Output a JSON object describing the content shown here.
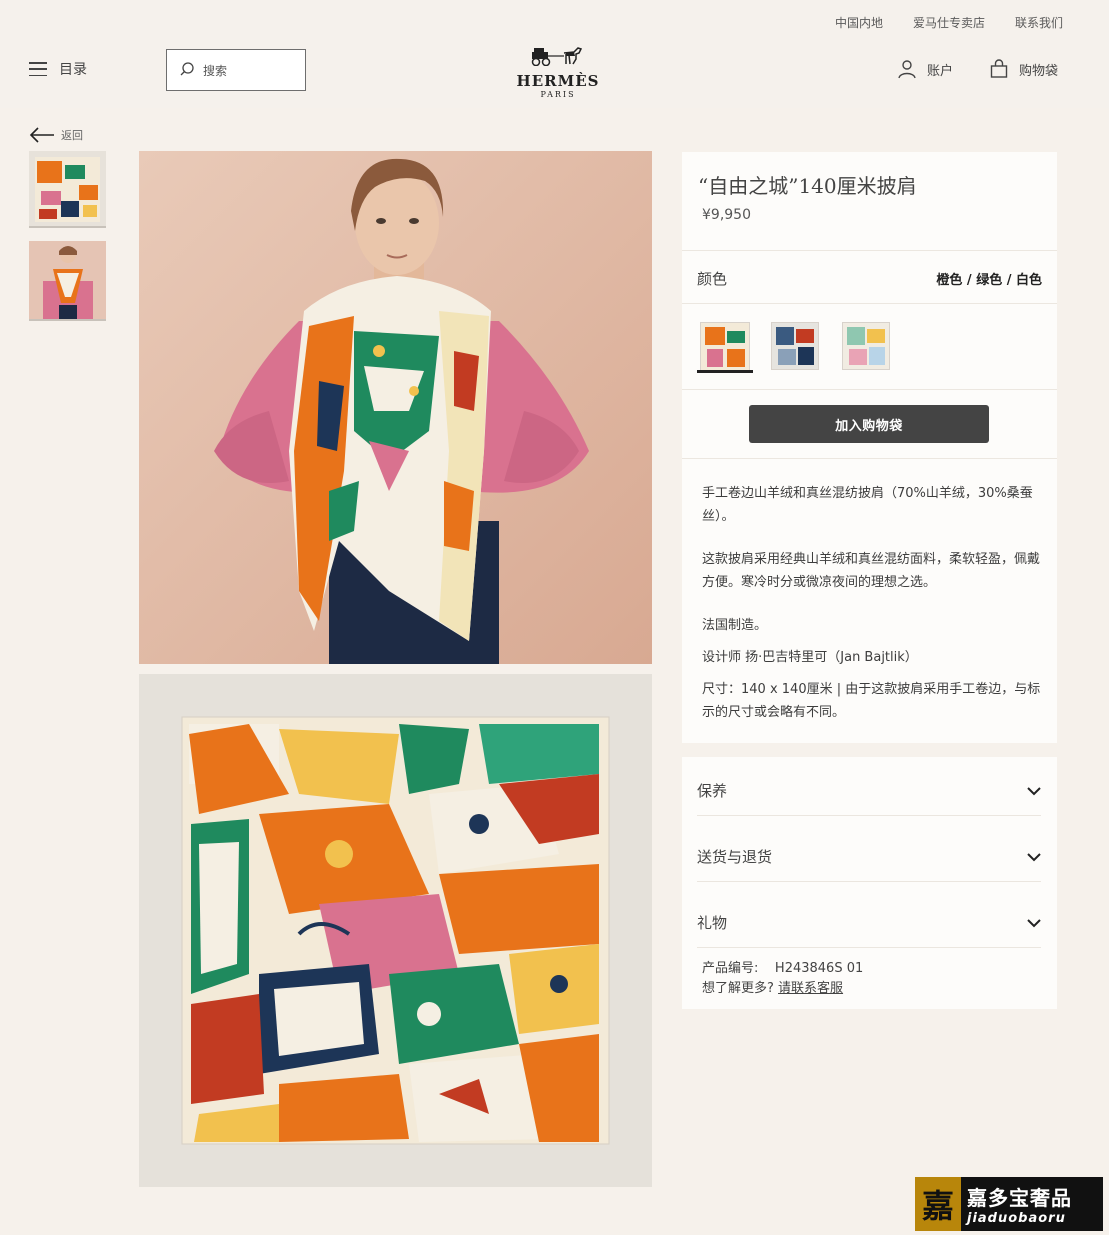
{
  "header": {
    "top_links": [
      "中国内地",
      "爱马仕专卖店",
      "联系我们"
    ],
    "menu_label": "目录",
    "search_placeholder": "搜索",
    "logo_brand": "HERMÈS",
    "logo_city": "PARIS",
    "account_label": "账户",
    "bag_label": "购物袋"
  },
  "back_label": "返回",
  "product": {
    "title": "“自由之城”140厘米披肩",
    "price": "¥9,950",
    "color_label": "颜色",
    "color_name": "橙色 / 绿色 / 白色",
    "add_to_bag": "加入购物袋",
    "desc1": "手工卷边山羊绒和真丝混纺披肩（70%山羊绒，30%桑蚕丝）。",
    "desc2": "这款披肩采用经典山羊绒和真丝混纺面料，柔软轻盈，佩戴方便。寒冷时分或微凉夜间的理想之选。",
    "desc3": "法国制造。",
    "desc4": "设计师 扬·巴吉特里可（Jan Bajtlik）",
    "desc5": "尺寸：140 x 140厘米 | 由于这款披肩采用手工卷边，与标示的尺寸或会略有不同。"
  },
  "accordion": [
    "保养",
    "送货与退货",
    "礼物"
  ],
  "reference": {
    "label": "产品编号:",
    "value": "H243846S 01",
    "more": "想了解更多?",
    "contact": "请联系客服"
  },
  "watermark": {
    "seal": "嘉",
    "cn": "嘉多宝奢品",
    "en": "jiaduobaoru"
  },
  "colors": {
    "orange": "#e8731a",
    "green": "#1f8a5e",
    "navy": "#1d3557",
    "pink": "#d9728f"
  }
}
